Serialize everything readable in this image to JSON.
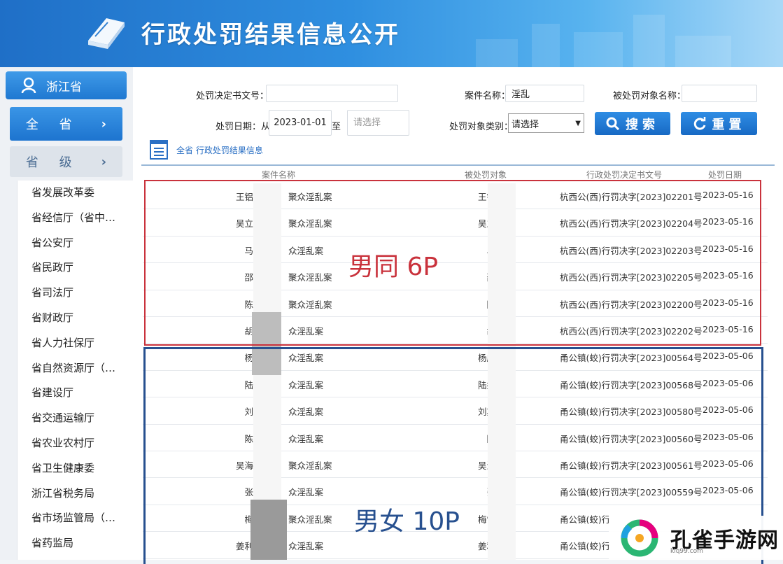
{
  "header": {
    "title": "行政处罚结果信息公开"
  },
  "sidebar": {
    "province": "浙江省",
    "all_label": "全 省",
    "level_label": "省 级",
    "departments": [
      "省发展改革委",
      "省经信厅（省中…",
      "省公安厅",
      "省民政厅",
      "省司法厅",
      "省财政厅",
      "省人力社保厅",
      "省自然资源厅（…",
      "省建设厅",
      "省交通运输厅",
      "省农业农村厅",
      "省卫生健康委",
      "浙江省税务局",
      "省市场监管局（…",
      "省药监局"
    ]
  },
  "form": {
    "doc_no_label": "处罚决定书文号：",
    "doc_no_value": "",
    "case_name_label": "案件名称：",
    "case_name_value": "淫乱",
    "target_name_label": "被处罚对象名称：",
    "target_name_value": "",
    "date_label": "处罚日期：从",
    "date_from": "2023-01-01",
    "date_to_label": "至",
    "date_to_placeholder": "请选择",
    "category_label": "处罚对象类别：",
    "category_value": "请选择",
    "search_label": "搜索",
    "reset_label": "重置"
  },
  "breadcrumb": "全省 行政处罚结果信息",
  "table": {
    "headers": [
      "案件名称",
      "被处罚对象",
      "行政处罚决定书文号",
      "处罚日期"
    ],
    "rows": [
      {
        "name_a": "王铝",
        "name_b": "聚众淫乱案",
        "target": "王铝",
        "doc": "杭西公(西)行罚决字[2023]02201号",
        "date": "2023-05-16"
      },
      {
        "name_a": "吴立",
        "name_b": "聚众淫乱案",
        "target": "吴立",
        "doc": "杭西公(西)行罚决字[2023]02204号",
        "date": "2023-05-16"
      },
      {
        "name_a": "马",
        "name_b": "众淫乱案",
        "target": "马",
        "doc": "杭西公(西)行罚决字[2023]02203号",
        "date": "2023-05-16"
      },
      {
        "name_a": "邵",
        "name_b": "聚众淫乱案",
        "target": "邵",
        "doc": "杭西公(西)行罚决字[2023]02205号",
        "date": "2023-05-16"
      },
      {
        "name_a": "陈",
        "name_b": "聚众淫乱案",
        "target": "陈",
        "doc": "杭西公(西)行罚决字[2023]02200号",
        "date": "2023-05-16"
      },
      {
        "name_a": "胡",
        "name_b": "众淫乱案",
        "target": "胡",
        "doc": "杭西公(西)行罚决字[2023]02202号",
        "date": "2023-05-16"
      },
      {
        "name_a": "杨",
        "name_b": "众淫乱案",
        "target": "杨庆",
        "doc": "甬公镇(蛟)行罚决字[2023]00564号",
        "date": "2023-05-06"
      },
      {
        "name_a": "陆",
        "name_b": "众淫乱案",
        "target": "陆挺",
        "doc": "甬公镇(蛟)行罚决字[2023]00568号",
        "date": "2023-05-06"
      },
      {
        "name_a": "刘",
        "name_b": "众淫乱案",
        "target": "刘斯",
        "doc": "甬公镇(蛟)行罚决字[2023]00580号",
        "date": "2023-05-06"
      },
      {
        "name_a": "陈",
        "name_b": "众淫乱案",
        "target": "陈",
        "doc": "甬公镇(蛟)行罚决字[2023]00560号",
        "date": "2023-05-06"
      },
      {
        "name_a": "吴海",
        "name_b": "聚众淫乱案",
        "target": "吴海",
        "doc": "甬公镇(蛟)行罚决字[2023]00561号",
        "date": "2023-05-06"
      },
      {
        "name_a": "张",
        "name_b": "众淫乱案",
        "target": "张",
        "doc": "甬公镇(蛟)行罚决字[2023]00559号",
        "date": "2023-05-06"
      },
      {
        "name_a": "梅",
        "name_b": "聚众淫乱案",
        "target": "梅雪",
        "doc": "甬公镇(蛟)行",
        "date": ""
      },
      {
        "name_a": "姜利",
        "name_b": "众淫乱案",
        "target": "姜利",
        "doc": "甬公镇(蛟)行",
        "date": ""
      }
    ]
  },
  "annotations": {
    "red": "男同 6P",
    "blue": "男女 10P"
  },
  "watermark": {
    "text": "孔雀手游网",
    "sub": "klq99.com"
  },
  "colors": {
    "header_blue": "#1f6fc7",
    "button_blue": "#1f78d1",
    "red_box": "#c9323c",
    "blue_box": "#27508f"
  }
}
